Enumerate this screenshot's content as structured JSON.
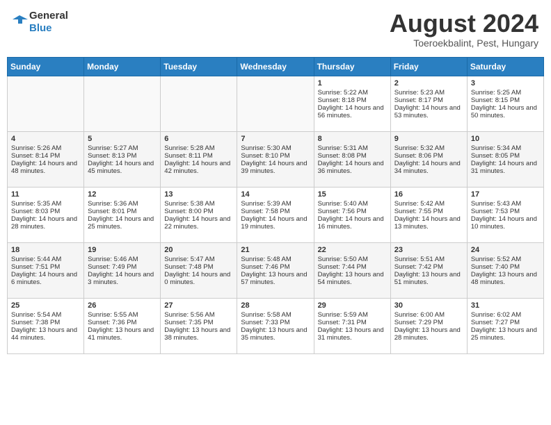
{
  "header": {
    "logo_line1": "General",
    "logo_line2": "Blue",
    "month_title": "August 2024",
    "subtitle": "Toeroekbalint, Pest, Hungary"
  },
  "weekdays": [
    "Sunday",
    "Monday",
    "Tuesday",
    "Wednesday",
    "Thursday",
    "Friday",
    "Saturday"
  ],
  "weeks": [
    [
      {
        "day": "",
        "text": ""
      },
      {
        "day": "",
        "text": ""
      },
      {
        "day": "",
        "text": ""
      },
      {
        "day": "",
        "text": ""
      },
      {
        "day": "1",
        "text": "Sunrise: 5:22 AM\nSunset: 8:18 PM\nDaylight: 14 hours and 56 minutes."
      },
      {
        "day": "2",
        "text": "Sunrise: 5:23 AM\nSunset: 8:17 PM\nDaylight: 14 hours and 53 minutes."
      },
      {
        "day": "3",
        "text": "Sunrise: 5:25 AM\nSunset: 8:15 PM\nDaylight: 14 hours and 50 minutes."
      }
    ],
    [
      {
        "day": "4",
        "text": "Sunrise: 5:26 AM\nSunset: 8:14 PM\nDaylight: 14 hours and 48 minutes."
      },
      {
        "day": "5",
        "text": "Sunrise: 5:27 AM\nSunset: 8:13 PM\nDaylight: 14 hours and 45 minutes."
      },
      {
        "day": "6",
        "text": "Sunrise: 5:28 AM\nSunset: 8:11 PM\nDaylight: 14 hours and 42 minutes."
      },
      {
        "day": "7",
        "text": "Sunrise: 5:30 AM\nSunset: 8:10 PM\nDaylight: 14 hours and 39 minutes."
      },
      {
        "day": "8",
        "text": "Sunrise: 5:31 AM\nSunset: 8:08 PM\nDaylight: 14 hours and 36 minutes."
      },
      {
        "day": "9",
        "text": "Sunrise: 5:32 AM\nSunset: 8:06 PM\nDaylight: 14 hours and 34 minutes."
      },
      {
        "day": "10",
        "text": "Sunrise: 5:34 AM\nSunset: 8:05 PM\nDaylight: 14 hours and 31 minutes."
      }
    ],
    [
      {
        "day": "11",
        "text": "Sunrise: 5:35 AM\nSunset: 8:03 PM\nDaylight: 14 hours and 28 minutes."
      },
      {
        "day": "12",
        "text": "Sunrise: 5:36 AM\nSunset: 8:01 PM\nDaylight: 14 hours and 25 minutes."
      },
      {
        "day": "13",
        "text": "Sunrise: 5:38 AM\nSunset: 8:00 PM\nDaylight: 14 hours and 22 minutes."
      },
      {
        "day": "14",
        "text": "Sunrise: 5:39 AM\nSunset: 7:58 PM\nDaylight: 14 hours and 19 minutes."
      },
      {
        "day": "15",
        "text": "Sunrise: 5:40 AM\nSunset: 7:56 PM\nDaylight: 14 hours and 16 minutes."
      },
      {
        "day": "16",
        "text": "Sunrise: 5:42 AM\nSunset: 7:55 PM\nDaylight: 14 hours and 13 minutes."
      },
      {
        "day": "17",
        "text": "Sunrise: 5:43 AM\nSunset: 7:53 PM\nDaylight: 14 hours and 10 minutes."
      }
    ],
    [
      {
        "day": "18",
        "text": "Sunrise: 5:44 AM\nSunset: 7:51 PM\nDaylight: 14 hours and 6 minutes."
      },
      {
        "day": "19",
        "text": "Sunrise: 5:46 AM\nSunset: 7:49 PM\nDaylight: 14 hours and 3 minutes."
      },
      {
        "day": "20",
        "text": "Sunrise: 5:47 AM\nSunset: 7:48 PM\nDaylight: 14 hours and 0 minutes."
      },
      {
        "day": "21",
        "text": "Sunrise: 5:48 AM\nSunset: 7:46 PM\nDaylight: 13 hours and 57 minutes."
      },
      {
        "day": "22",
        "text": "Sunrise: 5:50 AM\nSunset: 7:44 PM\nDaylight: 13 hours and 54 minutes."
      },
      {
        "day": "23",
        "text": "Sunrise: 5:51 AM\nSunset: 7:42 PM\nDaylight: 13 hours and 51 minutes."
      },
      {
        "day": "24",
        "text": "Sunrise: 5:52 AM\nSunset: 7:40 PM\nDaylight: 13 hours and 48 minutes."
      }
    ],
    [
      {
        "day": "25",
        "text": "Sunrise: 5:54 AM\nSunset: 7:38 PM\nDaylight: 13 hours and 44 minutes."
      },
      {
        "day": "26",
        "text": "Sunrise: 5:55 AM\nSunset: 7:36 PM\nDaylight: 13 hours and 41 minutes."
      },
      {
        "day": "27",
        "text": "Sunrise: 5:56 AM\nSunset: 7:35 PM\nDaylight: 13 hours and 38 minutes."
      },
      {
        "day": "28",
        "text": "Sunrise: 5:58 AM\nSunset: 7:33 PM\nDaylight: 13 hours and 35 minutes."
      },
      {
        "day": "29",
        "text": "Sunrise: 5:59 AM\nSunset: 7:31 PM\nDaylight: 13 hours and 31 minutes."
      },
      {
        "day": "30",
        "text": "Sunrise: 6:00 AM\nSunset: 7:29 PM\nDaylight: 13 hours and 28 minutes."
      },
      {
        "day": "31",
        "text": "Sunrise: 6:02 AM\nSunset: 7:27 PM\nDaylight: 13 hours and 25 minutes."
      }
    ]
  ]
}
